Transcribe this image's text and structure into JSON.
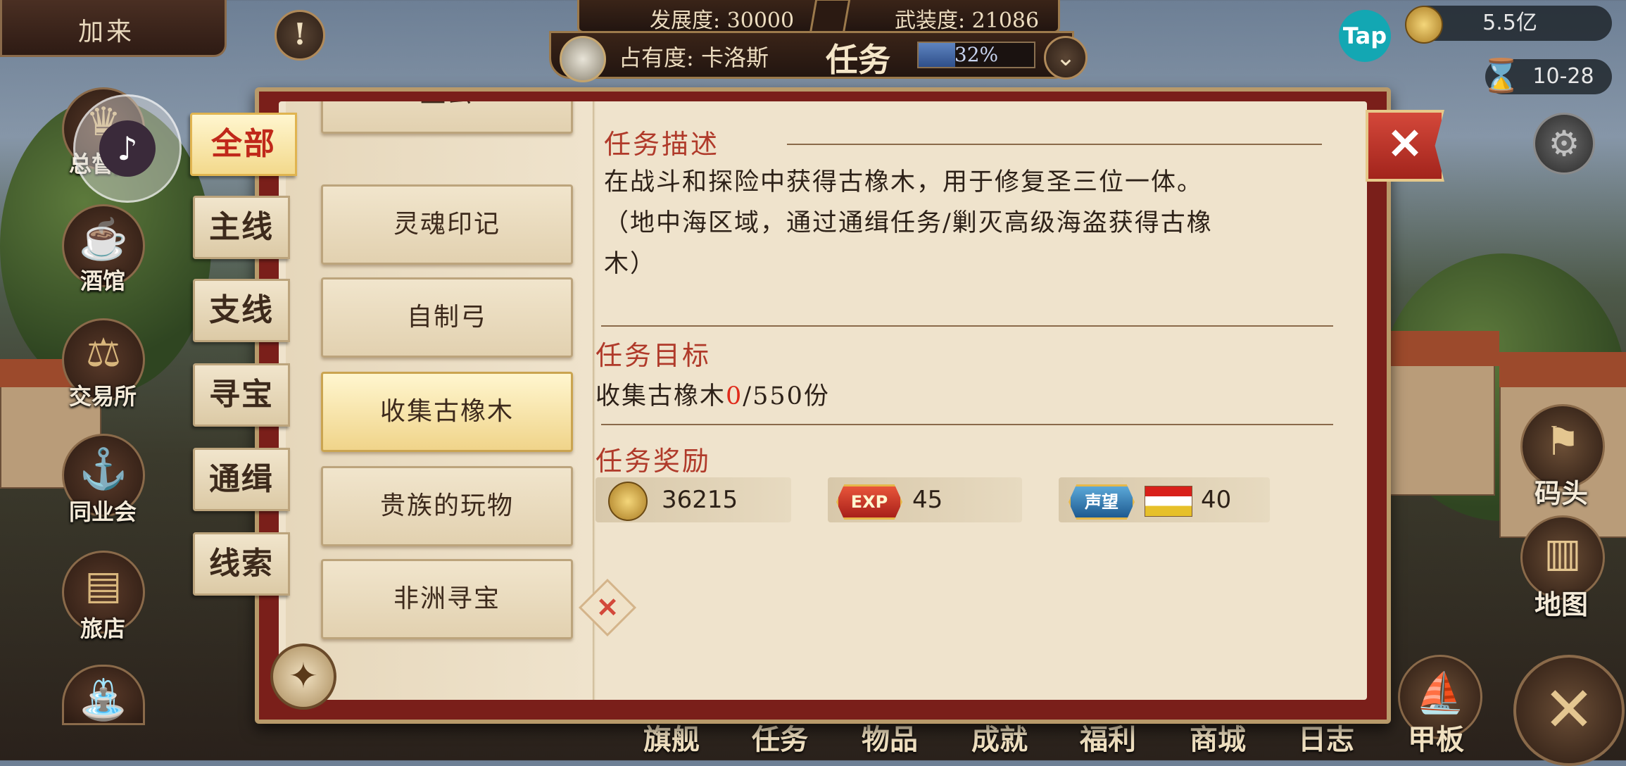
{
  "top_left": {
    "label": "加来"
  },
  "stats": {
    "development": "发展度: 30000",
    "armament": "武装度: 21086",
    "occupancy": "占有度: 卡洛斯",
    "mission_title": "任务",
    "progress_text": "32%",
    "progress_value": 0.32
  },
  "top_right": {
    "tap_label": "Tap",
    "money": "5.5亿",
    "date": "10-28"
  },
  "left_menu": {
    "items": [
      {
        "label": "总督府",
        "icon": "crown-icon"
      },
      {
        "label": "酒馆",
        "icon": "beer-mug-icon"
      },
      {
        "label": "交易所",
        "icon": "scales-icon"
      },
      {
        "label": "同业会",
        "icon": "anchor-shield-icon"
      },
      {
        "label": "旅店",
        "icon": "bed-icon"
      }
    ]
  },
  "right_menu": {
    "dock": "码头",
    "map": "地图"
  },
  "bottom_nav": {
    "items": [
      "旗舰",
      "任务",
      "物品",
      "成就",
      "福利",
      "商城",
      "日志",
      "甲板"
    ]
  },
  "categories": {
    "tabs": [
      "全部",
      "主线",
      "支线",
      "寻宝",
      "通缉",
      "线索"
    ],
    "selected": "全部"
  },
  "quest_list": {
    "items": [
      "盘云",
      "灵魂印记",
      "自制弓",
      "收集古橡木",
      "贵族的玩物",
      "非洲寻宝"
    ],
    "selected": "收集古橡木"
  },
  "detail": {
    "description_title": "任务描述",
    "description_line1": "在战斗和探险中获得古橡木，用于修复圣三位一体。",
    "description_line2": "（地中海区域，通过通缉任务/剿灭高级海盗获得古橡",
    "description_line3": "木）",
    "goal_title": "任务目标",
    "goal_prefix": "收集古橡木",
    "goal_current": "0",
    "goal_suffix": "/550份",
    "reward_title": "任务奖励",
    "rewards": {
      "coin": "36215",
      "exp_label": "EXP",
      "exp": "45",
      "reputation_label": "声望",
      "reputation": "40"
    }
  },
  "colors": {
    "accent_red": "#b03a2a",
    "goal_red": "#e02a1a",
    "dialog_frame": "#7a1f1a",
    "parchment": "#efe3cc"
  }
}
